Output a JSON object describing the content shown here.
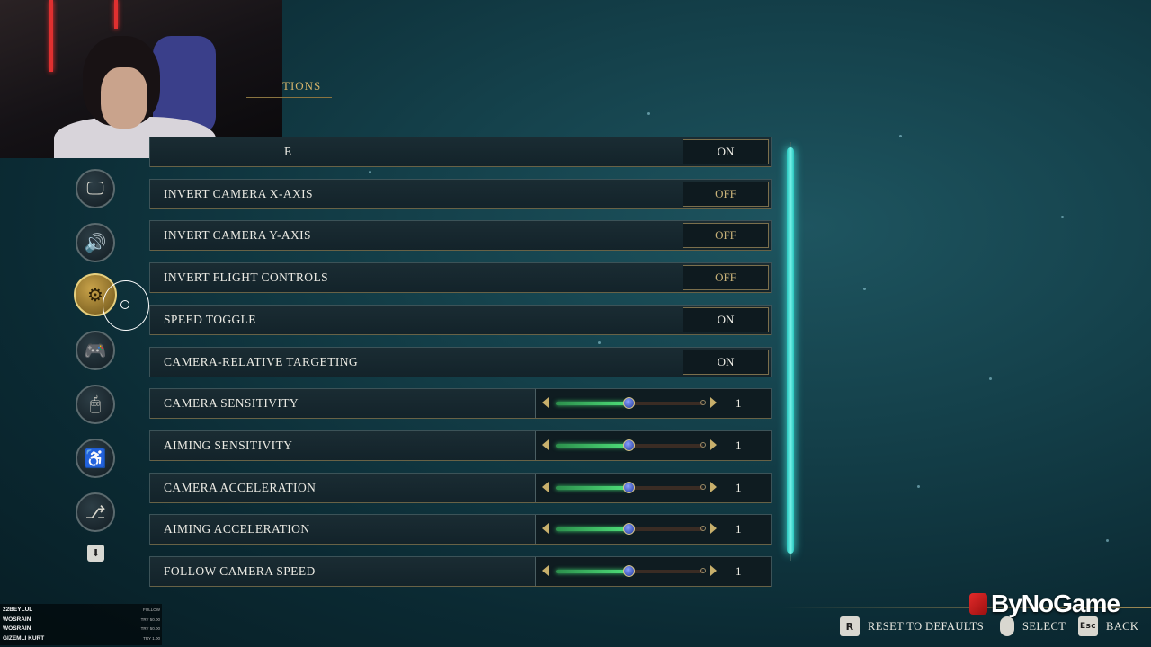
{
  "page": {
    "section_title": "TIONS"
  },
  "categories": [
    {
      "name": "display-icon",
      "glyph": "🖵",
      "active": false
    },
    {
      "name": "audio-icon",
      "glyph": "🔊",
      "active": false
    },
    {
      "name": "gameplay-gear-icon",
      "glyph": "⚙",
      "active": true
    },
    {
      "name": "controller-icon",
      "glyph": "🎮",
      "active": false
    },
    {
      "name": "mouse-icon",
      "glyph": "🖱",
      "active": false
    },
    {
      "name": "accessibility-icon",
      "glyph": "♿",
      "active": false
    },
    {
      "name": "network-icon",
      "glyph": "⎇",
      "active": false
    }
  ],
  "settings": [
    {
      "label": "E",
      "type": "toggle",
      "value": "ON"
    },
    {
      "label": "INVERT CAMERA X-AXIS",
      "type": "toggle",
      "value": "OFF"
    },
    {
      "label": "INVERT CAMERA Y-AXIS",
      "type": "toggle",
      "value": "OFF"
    },
    {
      "label": "INVERT FLIGHT CONTROLS",
      "type": "toggle",
      "value": "OFF"
    },
    {
      "label": "SPEED TOGGLE",
      "type": "toggle",
      "value": "ON"
    },
    {
      "label": "CAMERA-RELATIVE TARGETING",
      "type": "toggle",
      "value": "ON"
    },
    {
      "label": "CAMERA SENSITIVITY",
      "type": "slider",
      "value": "1",
      "fill_fraction": 0.5
    },
    {
      "label": "AIMING SENSITIVITY",
      "type": "slider",
      "value": "1",
      "fill_fraction": 0.5
    },
    {
      "label": "CAMERA ACCELERATION",
      "type": "slider",
      "value": "1",
      "fill_fraction": 0.5
    },
    {
      "label": "AIMING ACCELERATION",
      "type": "slider",
      "value": "1",
      "fill_fraction": 0.5
    },
    {
      "label": "FOLLOW CAMERA SPEED",
      "type": "slider",
      "value": "1",
      "fill_fraction": 0.5
    }
  ],
  "footer": {
    "reset_key": "R",
    "reset_label": "RESET TO DEFAULTS",
    "select_label": "SELECT",
    "back_key": "Esc",
    "back_label": "BACK",
    "brand": "ByNoGame"
  },
  "chat": [
    {
      "name": "22BEYLUL",
      "amount": "FOLLOW"
    },
    {
      "name": "WOSRAIN",
      "amount": "TRY 50.00"
    },
    {
      "name": "WOSRAIN",
      "amount": "TRY 50.00"
    },
    {
      "name": "GIZEMLI KURT",
      "amount": "TRY 1.00"
    }
  ],
  "colors": {
    "accent_gold": "#c8b06c",
    "slider_green": "#4fe07a",
    "scroll_cyan": "#3ee2d8"
  }
}
